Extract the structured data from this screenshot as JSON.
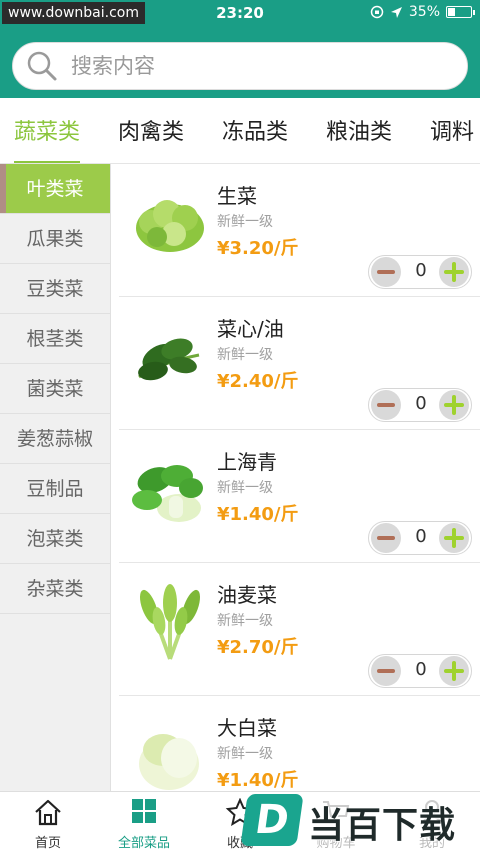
{
  "status_bar": {
    "watermark_site": "www.downbai.com",
    "time": "23:20",
    "battery": "35%",
    "battery_level": 0.35
  },
  "search": {
    "placeholder": "搜索内容"
  },
  "category_tabs": [
    {
      "label": "蔬菜类",
      "active": true
    },
    {
      "label": "肉禽类",
      "active": false
    },
    {
      "label": "冻品类",
      "active": false
    },
    {
      "label": "粮油类",
      "active": false
    },
    {
      "label": "调料",
      "active": false
    }
  ],
  "sidebar": {
    "items": [
      {
        "label": "叶类菜",
        "active": true
      },
      {
        "label": "瓜果类",
        "active": false
      },
      {
        "label": "豆类菜",
        "active": false
      },
      {
        "label": "根茎类",
        "active": false
      },
      {
        "label": "菌类菜",
        "active": false
      },
      {
        "label": "姜葱蒜椒",
        "active": false
      },
      {
        "label": "豆制品",
        "active": false
      },
      {
        "label": "泡菜类",
        "active": false
      },
      {
        "label": "杂菜类",
        "active": false
      }
    ]
  },
  "products": [
    {
      "name": "生菜",
      "grade": "新鲜一级",
      "price": "¥3.20/斤",
      "quantity": "0",
      "image_icon": "lettuce-icon"
    },
    {
      "name": "菜心/油",
      "grade": "新鲜一级",
      "price": "¥2.40/斤",
      "quantity": "0",
      "image_icon": "choy-sum-icon"
    },
    {
      "name": "上海青",
      "grade": "新鲜一级",
      "price": "¥1.40/斤",
      "quantity": "0",
      "image_icon": "bok-choy-icon"
    },
    {
      "name": "油麦菜",
      "grade": "新鲜一级",
      "price": "¥2.70/斤",
      "quantity": "0",
      "image_icon": "a-choy-icon"
    },
    {
      "name": "大白菜",
      "grade": "新鲜一级",
      "price": "¥1.40/斤",
      "quantity": "",
      "image_icon": "napa-cabbage-icon"
    }
  ],
  "bottom_nav": [
    {
      "label": "首页",
      "icon": "home-icon",
      "active": false
    },
    {
      "label": "全部菜品",
      "icon": "grid-icon",
      "active": true
    },
    {
      "label": "收藏",
      "icon": "star-icon",
      "active": false
    },
    {
      "label": "购物车",
      "icon": "cart-icon",
      "active": false
    },
    {
      "label": "我的",
      "icon": "user-icon",
      "active": false
    }
  ],
  "watermark_logo": {
    "mark": "D",
    "text": "当百下载"
  },
  "colors": {
    "header": "#1a9e86",
    "accent_green": "#8cc63e",
    "sidebar_active": "#9ccb4a",
    "price": "#f39c12",
    "plus": "#9fd22e",
    "minus": "#b06f57"
  }
}
